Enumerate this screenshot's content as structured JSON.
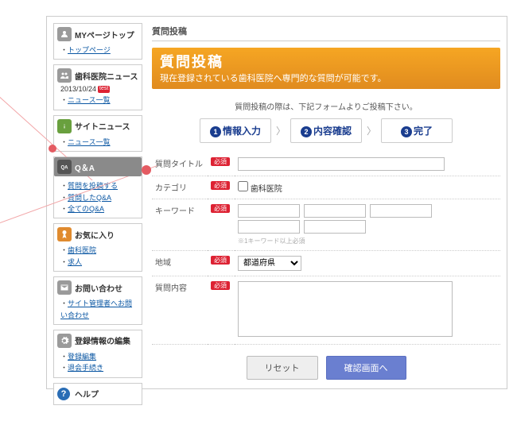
{
  "sidebar": {
    "mypage": {
      "title": "MYページトップ",
      "links": [
        "トップページ"
      ]
    },
    "news": {
      "title": "歯科医院ニュース",
      "date": "2013/10/24",
      "badge": "test",
      "links": [
        "ニュース一覧"
      ]
    },
    "site": {
      "title": "サイトニュース",
      "links": [
        "ニュース一覧"
      ]
    },
    "qa": {
      "title": "Q＆A",
      "links": [
        "質問を投稿する",
        "質問したQ&A",
        "全てのQ&A"
      ]
    },
    "fav": {
      "title": "お気に入り",
      "links": [
        "歯科医院",
        "求人"
      ]
    },
    "contact": {
      "title": "お問い合わせ",
      "links": [
        "サイト管理者へお問い合わせ"
      ]
    },
    "edit": {
      "title": "登録情報の編集",
      "links": [
        "登録編集",
        "退会手続き"
      ]
    },
    "help": {
      "title": "ヘルプ"
    }
  },
  "main": {
    "crumb": "質問投稿",
    "banner_title": "質問投稿",
    "banner_sub": "現在登録されている歯科医院へ専門的な質問が可能です。",
    "intro": "質問投稿の際は、下記フォームよりご投稿下さい。",
    "steps": [
      "情報入力",
      "内容確認",
      "完了"
    ],
    "fields": {
      "title_label": "質問タイトル",
      "category_label": "カテゴリ",
      "category_option": "歯科医院",
      "keyword_label": "キーワード",
      "keyword_note": "※1キーワード以上必須",
      "region_label": "地域",
      "region_option": "都道府県",
      "body_label": "質問内容",
      "required": "必須"
    },
    "buttons": {
      "reset": "リセット",
      "submit": "確認画面へ"
    }
  }
}
